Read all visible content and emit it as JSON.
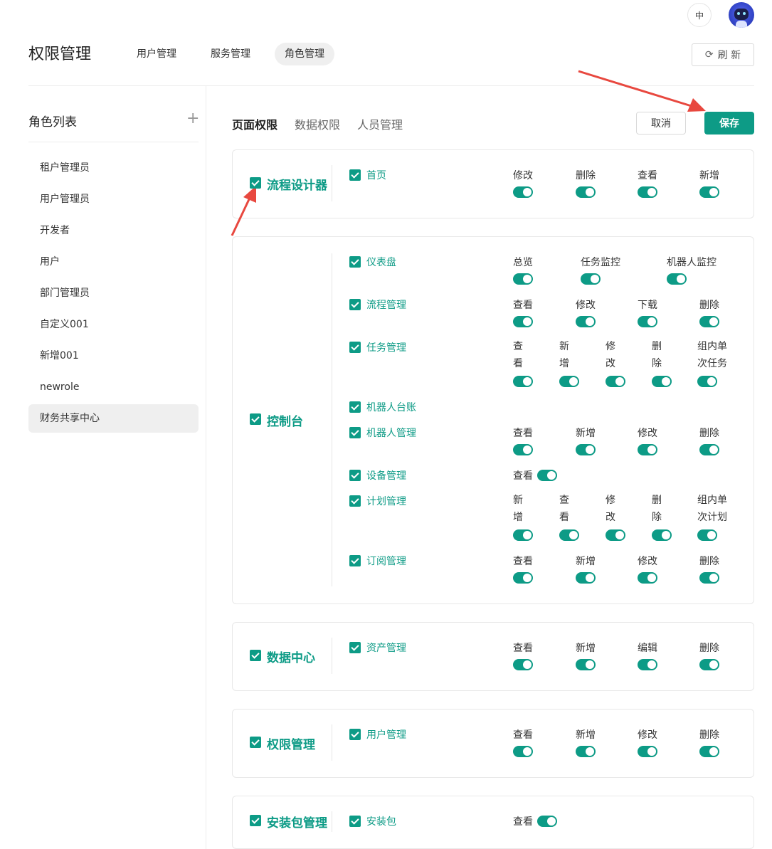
{
  "header": {
    "lang": "中",
    "title": "权限管理",
    "tabs": [
      {
        "label": "用户管理",
        "active": false
      },
      {
        "label": "服务管理",
        "active": false
      },
      {
        "label": "角色管理",
        "active": true
      }
    ],
    "refresh_label": "刷 新",
    "refresh_icon": "refresh-icon"
  },
  "sidebar": {
    "title": "角色列表",
    "add_icon": "plus-icon",
    "roles": [
      "租户管理员",
      "用户管理员",
      "开发者",
      "用户",
      "部门管理员",
      "自定义001",
      "新增001",
      "newrole",
      "财务共享中心"
    ],
    "active_role": "财务共享中心"
  },
  "main": {
    "tabs": [
      {
        "label": "页面权限",
        "active": true
      },
      {
        "label": "数据权限",
        "active": false
      },
      {
        "label": "人员管理",
        "active": false
      }
    ],
    "cancel_label": "取消",
    "save_label": "保存",
    "accent_color": "#0d9b86"
  },
  "groups": [
    {
      "name": "流程设计器",
      "checked": true,
      "pages": [
        {
          "name": "首页",
          "checked": true,
          "perms": [
            {
              "label": "修改",
              "on": true
            },
            {
              "label": "删除",
              "on": true
            },
            {
              "label": "查看",
              "on": true
            },
            {
              "label": "新增",
              "on": true
            }
          ]
        }
      ]
    },
    {
      "name": "控制台",
      "checked": true,
      "pages": [
        {
          "name": "仪表盘",
          "checked": true,
          "perms": [
            {
              "label": "总览",
              "on": true
            },
            {
              "label": "任务监控",
              "on": true
            },
            {
              "label": "机器人监控",
              "on": true
            }
          ]
        },
        {
          "name": "流程管理",
          "checked": true,
          "perms": [
            {
              "label": "查看",
              "on": true
            },
            {
              "label": "修改",
              "on": true
            },
            {
              "label": "下载",
              "on": true
            },
            {
              "label": "删除",
              "on": true
            }
          ]
        },
        {
          "name": "任务管理",
          "checked": true,
          "perms": [
            {
              "label": "查看",
              "on": true
            },
            {
              "label": "新增",
              "on": true
            },
            {
              "label": "修改",
              "on": true
            },
            {
              "label": "删除",
              "on": true
            },
            {
              "label": "组内单次任务",
              "on": true
            }
          ]
        },
        {
          "name": "机器人台账",
          "checked": true,
          "perms": []
        },
        {
          "name": "机器人管理",
          "checked": true,
          "perms": [
            {
              "label": "查看",
              "on": true
            },
            {
              "label": "新增",
              "on": true
            },
            {
              "label": "修改",
              "on": true
            },
            {
              "label": "删除",
              "on": true
            }
          ]
        },
        {
          "name": "设备管理",
          "checked": true,
          "perms": [
            {
              "label": "查看",
              "on": true
            }
          ]
        },
        {
          "name": "计划管理",
          "checked": true,
          "perms": [
            {
              "label": "新增",
              "on": true
            },
            {
              "label": "查看",
              "on": true
            },
            {
              "label": "修改",
              "on": true
            },
            {
              "label": "删除",
              "on": true
            },
            {
              "label": "组内单次计划",
              "on": true
            }
          ]
        },
        {
          "name": "订阅管理",
          "checked": true,
          "perms": [
            {
              "label": "查看",
              "on": true
            },
            {
              "label": "新增",
              "on": true
            },
            {
              "label": "修改",
              "on": true
            },
            {
              "label": "删除",
              "on": true
            }
          ]
        }
      ]
    },
    {
      "name": "数据中心",
      "checked": true,
      "pages": [
        {
          "name": "资产管理",
          "checked": true,
          "perms": [
            {
              "label": "查看",
              "on": true
            },
            {
              "label": "新增",
              "on": true
            },
            {
              "label": "编辑",
              "on": true
            },
            {
              "label": "删除",
              "on": true
            }
          ]
        }
      ]
    },
    {
      "name": "权限管理",
      "checked": true,
      "pages": [
        {
          "name": "用户管理",
          "checked": true,
          "perms": [
            {
              "label": "查看",
              "on": true
            },
            {
              "label": "新增",
              "on": true
            },
            {
              "label": "修改",
              "on": true
            },
            {
              "label": "删除",
              "on": true
            }
          ]
        }
      ]
    },
    {
      "name": "安装包管理",
      "checked": true,
      "pages": [
        {
          "name": "安装包",
          "checked": true,
          "perms": [
            {
              "label": "查看",
              "on": true
            }
          ]
        }
      ]
    }
  ],
  "annotations": {
    "arrow_color": "#e8483f"
  }
}
